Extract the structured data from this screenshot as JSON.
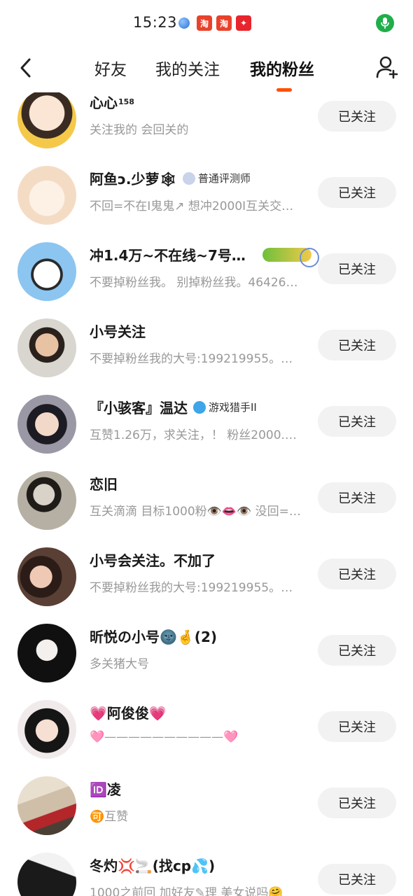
{
  "status": {
    "time": "15:23",
    "icons": [
      "globe-icon",
      "taobao-icon",
      "taobao-icon",
      "app-icon"
    ]
  },
  "nav": {
    "tabs": [
      {
        "label": "好友",
        "active": false
      },
      {
        "label": "我的关注",
        "active": false
      },
      {
        "label": "我的粉丝",
        "active": true
      }
    ],
    "accent": "#ff5000"
  },
  "fans": [
    {
      "name": "心心",
      "sup": "158",
      "badge": "",
      "sub": "关注我的 会回关的",
      "button": "已关注",
      "avatar_color": "#f4c94a"
    },
    {
      "name": "阿鱼ɔ.少萝🕸",
      "sup": "",
      "badge": "普通评测师",
      "sub": "不回=不在I鬼鬼↗ 想冲2000I互关交…",
      "button": "已关注",
      "avatar_color": "#f7e3d2"
    },
    {
      "name": "冲1.4万~不在线~7号…",
      "sup": "",
      "badge": "",
      "sub": "不要掉粉丝我。 别掉粉丝我。46426…",
      "button": "已关注",
      "avatar_color": "#8cc5f0"
    },
    {
      "name": "小号关注",
      "sup": "",
      "badge": "",
      "sub": "不要掉粉丝我的大号:199219955。…",
      "button": "已关注",
      "avatar_color": "#6a5a4e"
    },
    {
      "name": "『小骇客』温达",
      "sup": "",
      "badge": "游戏猎手II",
      "sub": "互赞1.26万，求关注，！ 粉丝2000.…",
      "button": "已关注",
      "avatar_color": "#3b3a48"
    },
    {
      "name": "恋旧",
      "sup": "",
      "badge": "",
      "sub": "互关滴滴 目标1000粉👁️👄👁️ 没回=…",
      "button": "已关注",
      "avatar_color": "#8c8678"
    },
    {
      "name": "小号会关注。不加了",
      "sup": "",
      "badge": "",
      "sub": "不要掉粉丝我的大号:199219955。…",
      "button": "已关注",
      "avatar_color": "#3d2a25"
    },
    {
      "name": "昕悦の小号🌚🤞(2)",
      "sup": "",
      "badge": "",
      "sub": "多关猪大号",
      "button": "已关注",
      "avatar_color": "#222222"
    },
    {
      "name": "💗阿俊俊💗",
      "sup": "",
      "badge": "",
      "sub": "🩷——————————🩷",
      "button": "已关注",
      "avatar_color": "#2b2b2b"
    },
    {
      "name": "🆔凌",
      "sup": "",
      "badge": "",
      "sub": "🉑互赞",
      "button": "已关注",
      "avatar_color": "#a99c88"
    },
    {
      "name": "冬灼💢🚬(找cp💦)",
      "sup": "",
      "badge": "",
      "sub": "1000之前回 加好友✎理 美女说吗🤗",
      "button": "已关注",
      "avatar_color": "#1e1e1e"
    }
  ]
}
